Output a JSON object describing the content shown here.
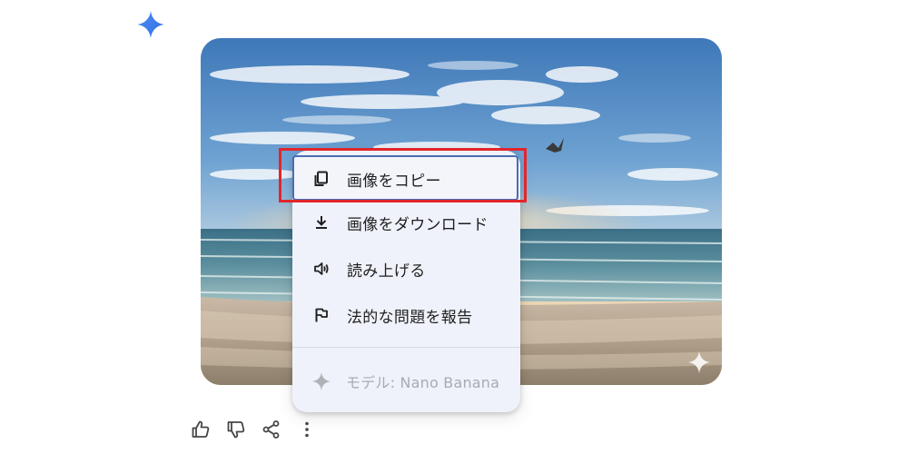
{
  "header": {
    "assistant_icon": "gemini-sparkle-icon",
    "assistant_icon_color": "#3b78e7"
  },
  "image": {
    "description_icon": "sparkle-watermark-icon"
  },
  "context_menu": {
    "items": [
      {
        "label": "画像をコピー",
        "icon": "copy-icon"
      },
      {
        "label": "画像をダウンロード",
        "icon": "download-icon"
      },
      {
        "label": "読み上げる",
        "icon": "speaker-icon"
      },
      {
        "label": "法的な問題を報告",
        "icon": "flag-icon"
      }
    ],
    "model_label": "モデル: Nano Banana",
    "model_icon": "sparkle-icon"
  },
  "actions": [
    {
      "icon": "thumbs-up-icon"
    },
    {
      "icon": "thumbs-down-icon"
    },
    {
      "icon": "share-icon"
    },
    {
      "icon": "more-vert-icon"
    }
  ],
  "colors": {
    "highlight": "#e3252a",
    "menu_background": "#eff2fa",
    "focus_ring": "#4a6db4",
    "model_text": "#a9abb1"
  }
}
